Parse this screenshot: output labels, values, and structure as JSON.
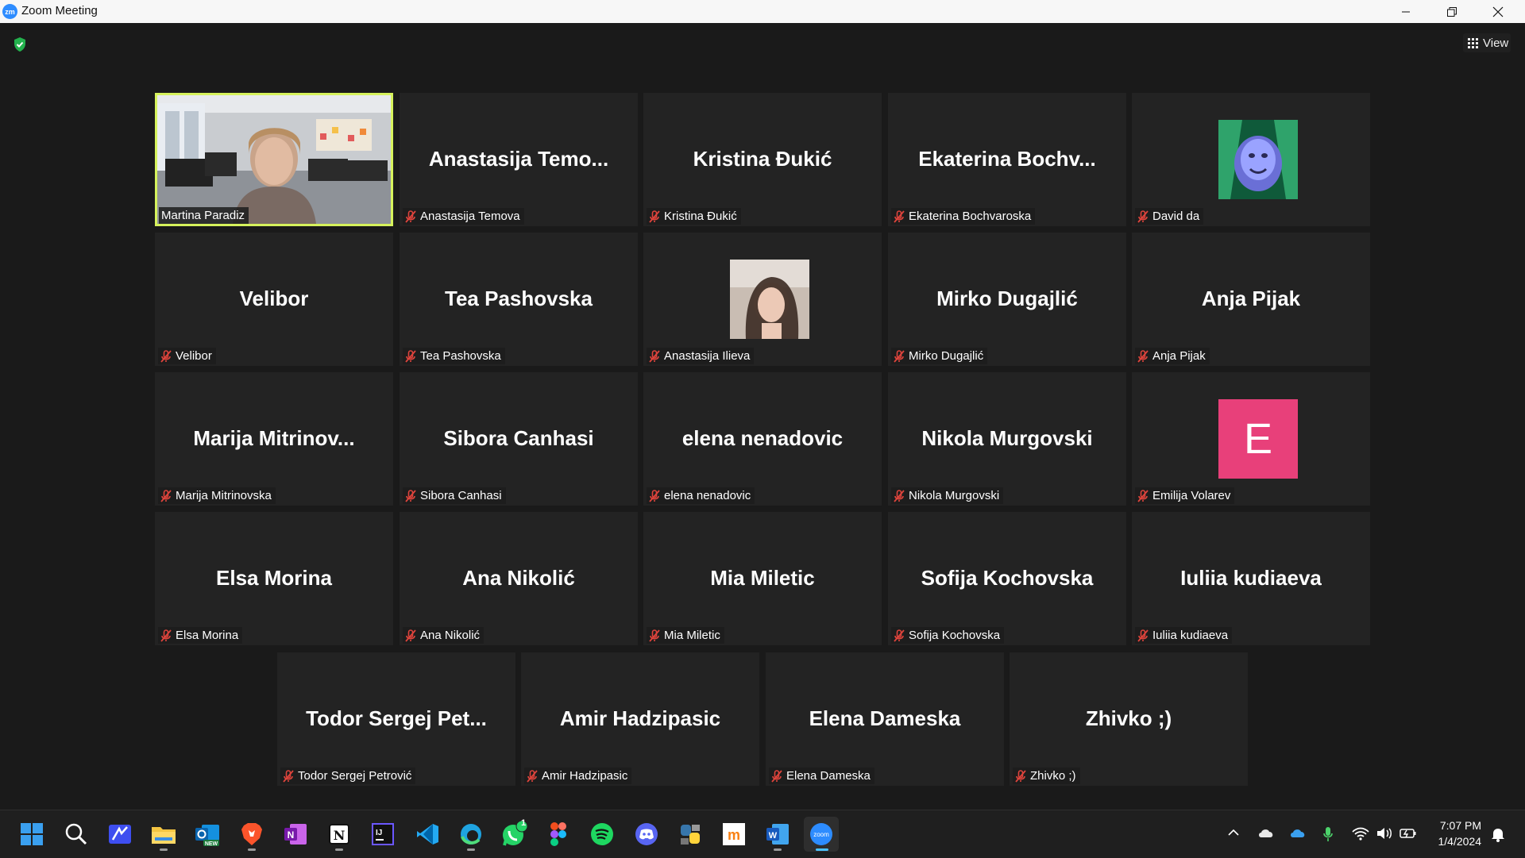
{
  "window": {
    "title": "Zoom Meeting",
    "app_icon_text": "zm"
  },
  "toolbar": {
    "view_label": "View"
  },
  "participants": [
    {
      "display": "",
      "label": "Martina Paradiz",
      "type": "video",
      "active": true
    },
    {
      "display": "Anastasija  Temo...",
      "label": "Anastasija Temova",
      "type": "name"
    },
    {
      "display": "Kristina Đukić",
      "label": "Kristina Đukić",
      "type": "name"
    },
    {
      "display": "Ekaterina  Bochv...",
      "label": "Ekaterina Bochvaroska",
      "type": "name"
    },
    {
      "display": "",
      "label": "David da",
      "type": "avatar-image"
    },
    {
      "display": "Velibor",
      "label": "Velibor",
      "type": "name"
    },
    {
      "display": "Tea Pashovska",
      "label": "Tea Pashovska",
      "type": "name"
    },
    {
      "display": "",
      "label": "Anastasija Ilieva",
      "type": "avatar-photo"
    },
    {
      "display": "Mirko Dugajlić",
      "label": "Mirko Dugajlić",
      "type": "name"
    },
    {
      "display": "Anja Pijak",
      "label": "Anja Pijak",
      "type": "name"
    },
    {
      "display": "Marija  Mitrinov...",
      "label": "Marija Mitrinovska",
      "type": "name"
    },
    {
      "display": "Sibora Canhasi",
      "label": "Sibora Canhasi",
      "type": "name"
    },
    {
      "display": "elena nenadovic",
      "label": "elena nenadovic",
      "type": "name"
    },
    {
      "display": "Nikola Murgovski",
      "label": "Nikola Murgovski",
      "type": "name"
    },
    {
      "display": "E",
      "label": "Emilija Volarev",
      "type": "avatar-letter",
      "avatar_color": "#e8407a"
    },
    {
      "display": "Elsa Morina",
      "label": "Elsa Morina",
      "type": "name"
    },
    {
      "display": "Ana Nikolić",
      "label": "Ana Nikolić",
      "type": "name"
    },
    {
      "display": "Mia Miletic",
      "label": "Mia Miletic",
      "type": "name"
    },
    {
      "display": "Sofija Kochovska",
      "label": "Sofija Kochovska",
      "type": "name"
    },
    {
      "display": "Iuliia kudiaeva",
      "label": "Iuliia kudiaeva",
      "type": "name"
    },
    {
      "display": "Todor  Sergej  Pet...",
      "label": "Todor Sergej Petrović",
      "type": "name"
    },
    {
      "display": "Amir Hadzipasic",
      "label": "Amir Hadzipasic",
      "type": "name"
    },
    {
      "display": "Elena Dameska",
      "label": "Elena Dameska",
      "type": "name"
    },
    {
      "display": "Zhivko ;)",
      "label": "Zhivko ;)",
      "type": "name"
    }
  ],
  "taskbar": {
    "apps": [
      "start-icon",
      "search-icon",
      "app-icon",
      "file-explorer-icon",
      "outlook-icon",
      "brave-icon",
      "onenote-icon",
      "notion-icon",
      "intellij-icon",
      "vscode-icon",
      "edge-icon",
      "whatsapp-icon",
      "figma-icon",
      "spotify-icon",
      "discord-icon",
      "python-icon",
      "moodle-icon",
      "word-icon",
      "zoom-icon"
    ],
    "whatsapp_badge": "1",
    "outlook_badge": "NEW"
  },
  "clock": {
    "time": "7:07 PM",
    "date": "1/4/2024"
  },
  "colors": {
    "active_speaker": "#d6f25c",
    "muted_mic": "#e0443c",
    "accent": "#2d8cff"
  }
}
